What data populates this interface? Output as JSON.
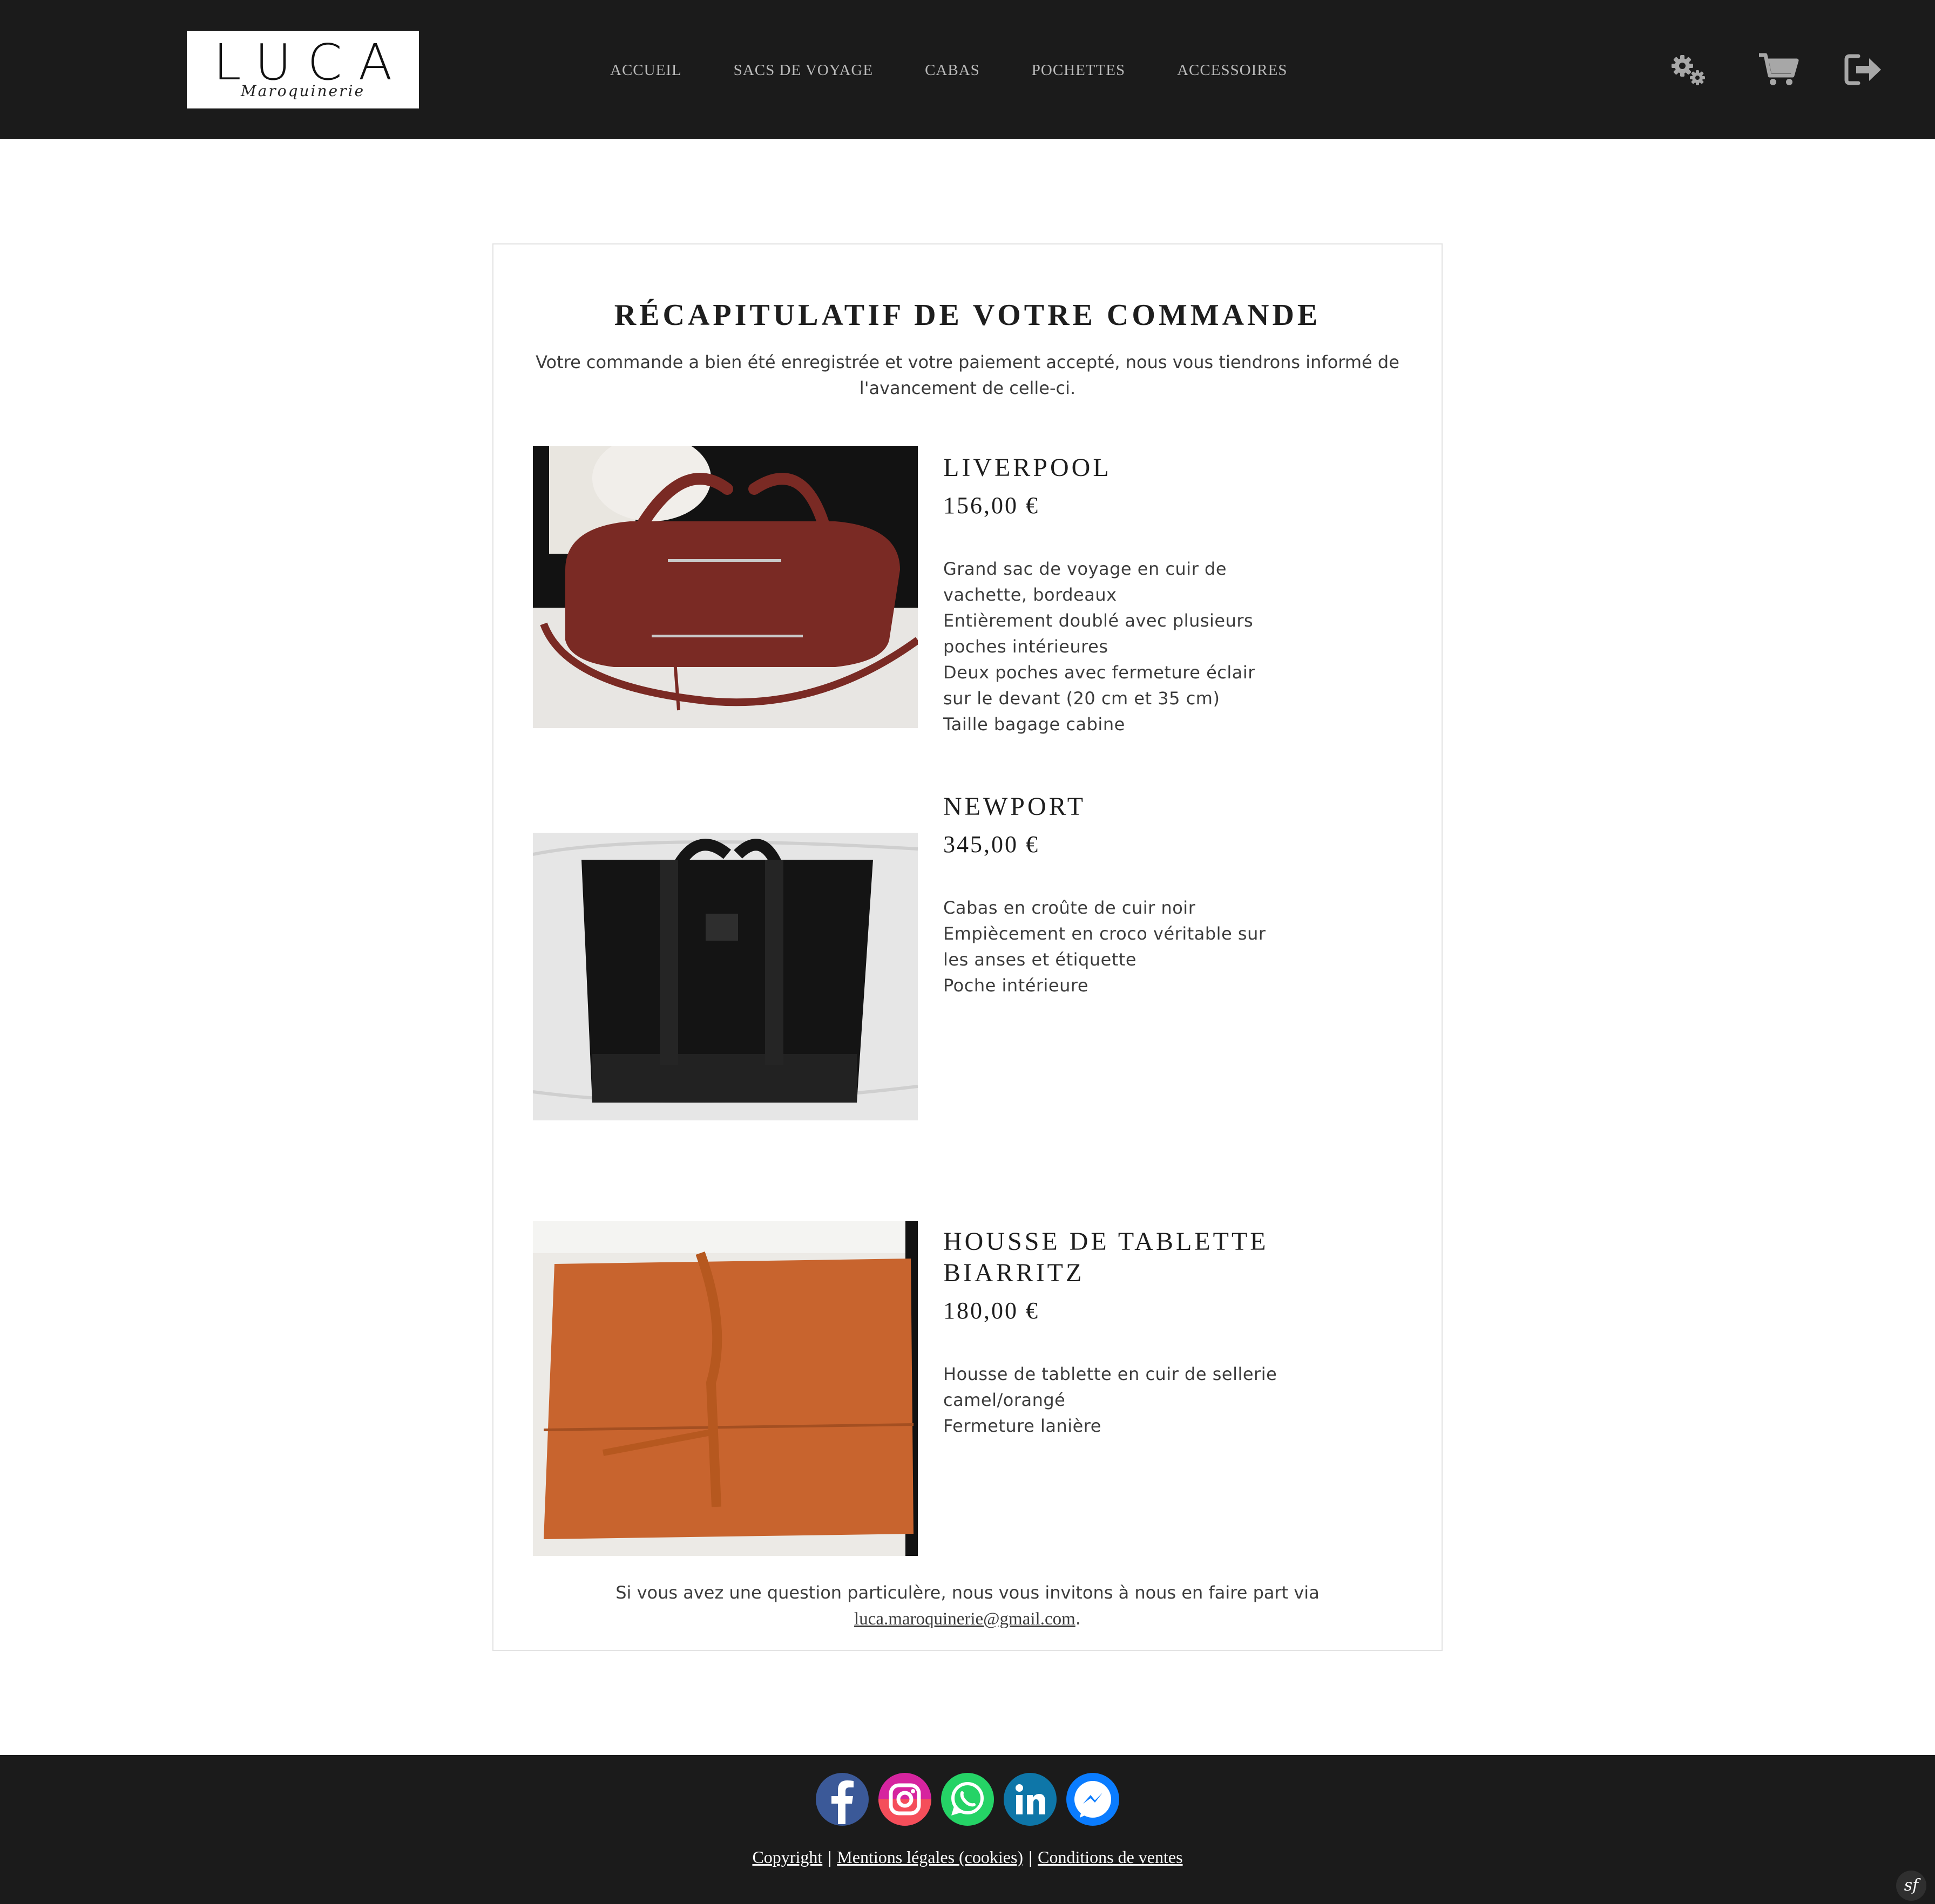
{
  "brand": {
    "name": "LUCA",
    "tagline": "Maroquinerie"
  },
  "nav": {
    "items": [
      {
        "label": "ACCUEIL"
      },
      {
        "label": "SACS DE VOYAGE"
      },
      {
        "label": "CABAS"
      },
      {
        "label": "POCHETTES"
      },
      {
        "label": "ACCESSOIRES"
      }
    ]
  },
  "header_icons": [
    "settings-gears-icon",
    "shopping-cart-icon",
    "logout-icon"
  ],
  "summary": {
    "title": "RÉCAPITULATIF DE VOTRE COMMANDE",
    "intro": "Votre commande a bien été enregistrée et votre paiement accepté, nous vous tiendrons informé de l'avancement de celle-ci."
  },
  "products": [
    {
      "name": "LIVERPOOL",
      "price": "156,00 €",
      "image_color": "#7a2a24",
      "description": [
        "Grand sac de voyage en cuir de",
        "vachette, bordeaux",
        "Entièrement doublé avec plusieurs",
        "poches intérieures",
        "Deux poches avec fermeture éclair",
        "sur le devant (20 cm et 35 cm)",
        "Taille bagage cabine"
      ]
    },
    {
      "name": "NEWPORT",
      "price": "345,00 €",
      "image_color": "#111111",
      "description": [
        "Cabas en croûte de cuir noir",
        "Empiècement en croco véritable sur",
        "les anses et étiquette",
        "Poche intérieure"
      ]
    },
    {
      "name_line1": "HOUSSE DE TABLETTE",
      "name_line2": "BIARRITZ",
      "price": "180,00 €",
      "image_color": "#c8642e",
      "description": [
        "Housse de tablette en cuir de sellerie",
        "camel/orangé",
        "Fermeture lanière"
      ]
    }
  ],
  "closing": {
    "text": "Si vous avez une question particulère, nous vous invitons à nous en faire part via",
    "email": "luca.maroquinerie@gmail.com",
    "end": "."
  },
  "footer": {
    "social": [
      "facebook-icon",
      "instagram-icon",
      "whatsapp-icon",
      "linkedin-icon",
      "messenger-icon"
    ],
    "links": {
      "copyright": "Copyright",
      "legal": "Mentions légales (cookies)",
      "terms": "Conditions de ventes",
      "separator": "|"
    }
  },
  "colors": {
    "header_bg": "#1b1b1b",
    "nav_text": "#b9b9b9",
    "icon_gray": "#a7a7a7",
    "card_border": "#e2e2e2"
  }
}
